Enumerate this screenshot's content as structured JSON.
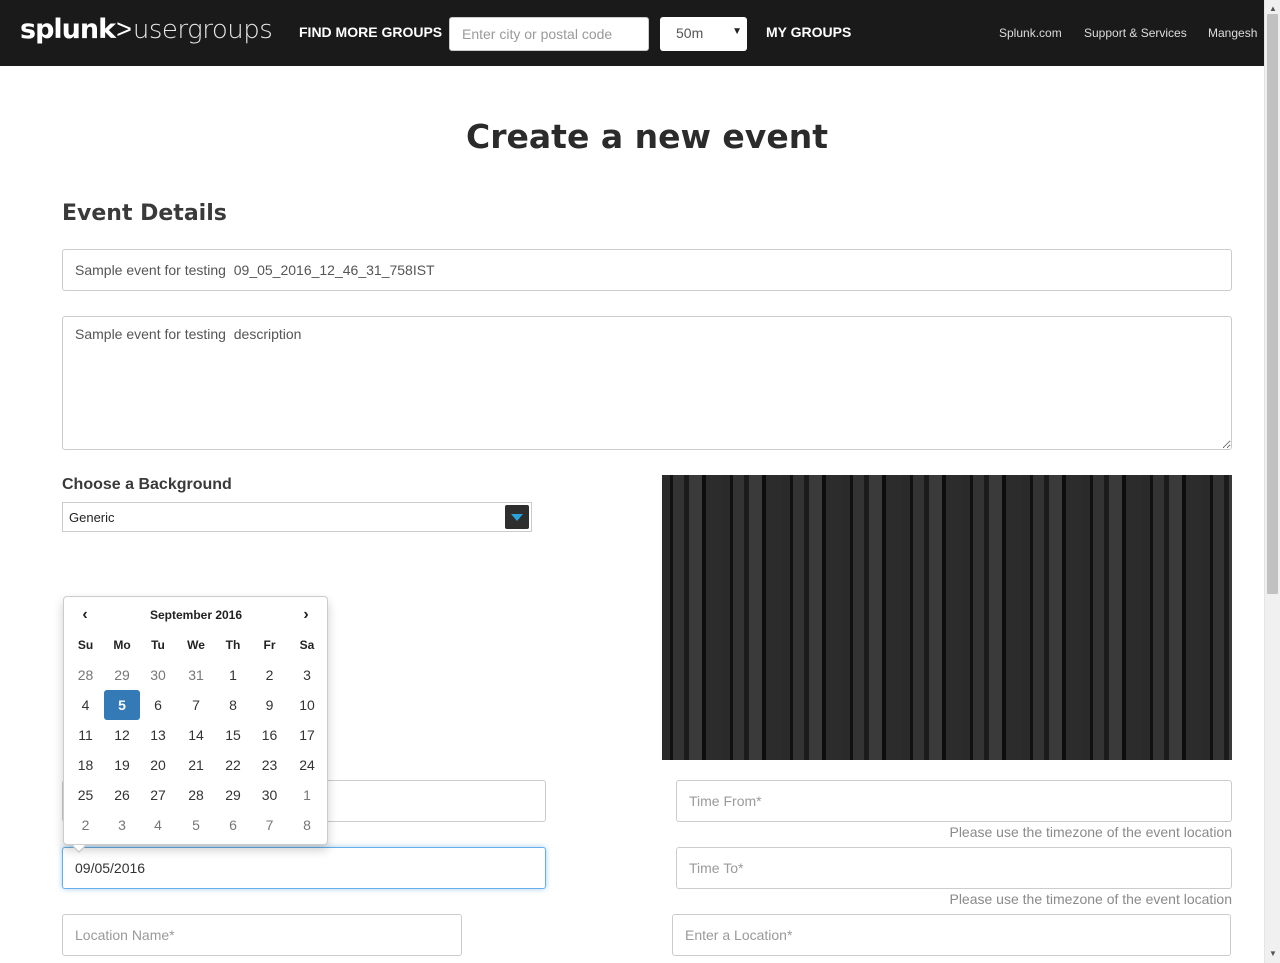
{
  "brand": {
    "name": "splunk",
    "separator": ">",
    "product": "usergroups"
  },
  "nav": {
    "find_groups": "FIND MORE GROUPS",
    "search_placeholder": "Enter city or postal code",
    "radius": "50m",
    "my_groups": "MY GROUPS",
    "links": [
      "Splunk.com",
      "Support & Services",
      "Mangesh"
    ]
  },
  "page": {
    "title": "Create a new event"
  },
  "details": {
    "heading": "Event Details",
    "name_value": "Sample event for testing  09_05_2016_12_46_31_758IST",
    "description_value": "Sample event for testing  description"
  },
  "background": {
    "label": "Choose a Background",
    "selected": "Generic"
  },
  "datepicker": {
    "month_label": "September 2016",
    "prev_icon": "chevron-left-icon",
    "next_icon": "chevron-right-icon",
    "weekdays": [
      "Su",
      "Mo",
      "Tu",
      "We",
      "Th",
      "Fr",
      "Sa"
    ],
    "weeks": [
      [
        "28",
        "29",
        "30",
        "31",
        "1",
        "2",
        "3"
      ],
      [
        "4",
        "5",
        "6",
        "7",
        "8",
        "9",
        "10"
      ],
      [
        "11",
        "12",
        "13",
        "14",
        "15",
        "16",
        "17"
      ],
      [
        "18",
        "19",
        "20",
        "21",
        "22",
        "23",
        "24"
      ],
      [
        "25",
        "26",
        "27",
        "28",
        "29",
        "30",
        "1"
      ],
      [
        "2",
        "3",
        "4",
        "5",
        "6",
        "7",
        "8"
      ]
    ],
    "selected_day": "5",
    "accent": "#337ab7"
  },
  "schedule": {
    "end_date_value": "09/05/2016",
    "time_from_placeholder": "Time From*",
    "time_to_placeholder": "Time To*",
    "timezone_hint": "Please use the timezone of the event location"
  },
  "location": {
    "name_placeholder": "Location Name*",
    "address_placeholder": "Enter a Location*"
  }
}
